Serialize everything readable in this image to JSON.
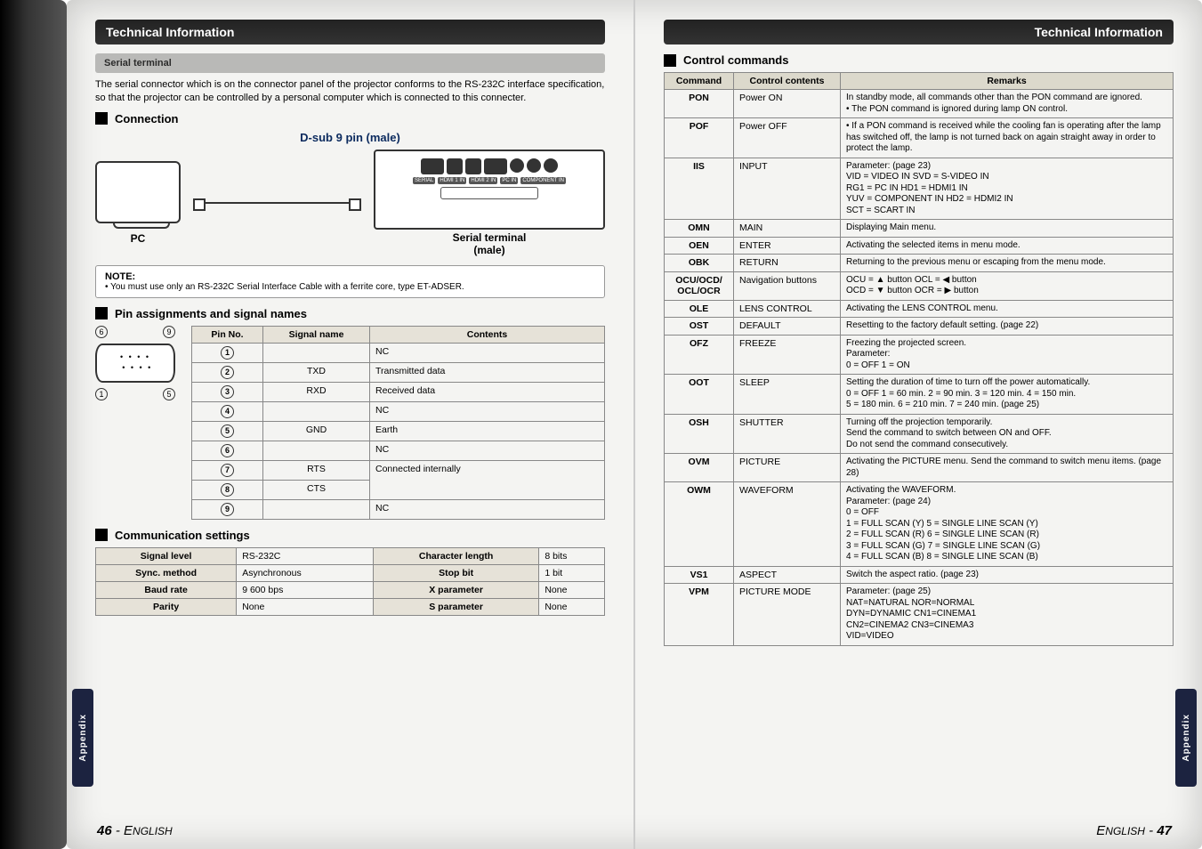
{
  "left": {
    "header": "Technical Information",
    "serial_hdr": "Serial terminal",
    "intro": "The serial connector which is on the connector panel of the projector conforms to the RS-232C interface specification, so that the projector can be controlled by a personal computer which is connected to this connecter.",
    "connection_title": "Connection",
    "dsub_label": "D-sub 9 pin (male)",
    "pc_label": "PC",
    "term_label1": "Serial terminal",
    "term_label2": "(male)",
    "note_title": "NOTE:",
    "note_body": "• You must use only an RS-232C Serial Interface Cable with a ferrite core, type ET-ADSER.",
    "pins_title": "Pin assignments and signal names",
    "pin_headers": [
      "Pin No.",
      "Signal name",
      "Contents"
    ],
    "pins": [
      {
        "n": "1",
        "sig": "",
        "cont": "NC"
      },
      {
        "n": "2",
        "sig": "TXD",
        "cont": "Transmitted data"
      },
      {
        "n": "3",
        "sig": "RXD",
        "cont": "Received data"
      },
      {
        "n": "4",
        "sig": "",
        "cont": "NC"
      },
      {
        "n": "5",
        "sig": "GND",
        "cont": "Earth"
      },
      {
        "n": "6",
        "sig": "",
        "cont": "NC"
      },
      {
        "n": "7",
        "sig": "RTS",
        "cont": "Connected internally"
      },
      {
        "n": "8",
        "sig": "CTS",
        "cont": ""
      },
      {
        "n": "9",
        "sig": "",
        "cont": "NC"
      }
    ],
    "dia_top": [
      "6",
      "9"
    ],
    "dia_bot": [
      "1",
      "5"
    ],
    "comm_title": "Communication settings",
    "comm": [
      {
        "k1": "Signal level",
        "v1": "RS-232C",
        "k2": "Character length",
        "v2": "8 bits"
      },
      {
        "k1": "Sync. method",
        "v1": "Asynchronous",
        "k2": "Stop bit",
        "v2": "1 bit"
      },
      {
        "k1": "Baud rate",
        "v1": "9 600 bps",
        "k2": "X parameter",
        "v2": "None"
      },
      {
        "k1": "Parity",
        "v1": "None",
        "k2": "S parameter",
        "v2": "None"
      }
    ],
    "appendix": "Appendix",
    "footer": "46 - ENGLISH"
  },
  "right": {
    "header": "Technical Information",
    "cc_title": "Control commands",
    "cmd_headers": [
      "Command",
      "Control contents",
      "Remarks"
    ],
    "cmds": [
      {
        "c": "PON",
        "n": "Power ON",
        "r": "In standby mode, all commands other than the PON command are ignored.\n• The PON command is ignored during lamp ON control."
      },
      {
        "c": "POF",
        "n": "Power OFF",
        "r": "• If a PON command is received while the cooling fan is operating after the lamp has switched off, the lamp is not turned back on again straight away in order to protect the lamp."
      },
      {
        "c": "IIS",
        "n": "INPUT",
        "r": "Parameter: (page 23)\nVID = VIDEO IN          SVD = S-VIDEO IN\nRG1 = PC IN             HD1 = HDMI1 IN\nYUV = COMPONENT IN      HD2 = HDMI2 IN\n                        SCT = SCART IN"
      },
      {
        "c": "OMN",
        "n": "MAIN",
        "r": "Displaying Main menu."
      },
      {
        "c": "OEN",
        "n": "ENTER",
        "r": "Activating the selected items in menu mode."
      },
      {
        "c": "OBK",
        "n": "RETURN",
        "r": "Returning to the previous menu or escaping from the menu mode."
      },
      {
        "c": "OCU/OCD/ OCL/OCR",
        "n": "Navigation buttons",
        "r": "OCU = ▲ button        OCL = ◀ button\nOCD = ▼ button        OCR = ▶ button"
      },
      {
        "c": "OLE",
        "n": "LENS CONTROL",
        "r": "Activating the LENS CONTROL menu."
      },
      {
        "c": "OST",
        "n": "DEFAULT",
        "r": "Resetting to the factory default setting. (page 22)"
      },
      {
        "c": "OFZ",
        "n": "FREEZE",
        "r": "Freezing the projected screen.\nParameter:\n0 = OFF                 1 = ON"
      },
      {
        "c": "OOT",
        "n": "SLEEP",
        "r": "Setting the duration of time to turn off the power automatically.\n0 = OFF   1 = 60 min.   2 = 90 min.   3 = 120 min.   4 = 150 min.\n5 = 180 min.   6 = 210 min.   7 = 240 min.   (page 25)"
      },
      {
        "c": "OSH",
        "n": "SHUTTER",
        "r": "Turning off the projection temporarily.\nSend the command to switch between ON and OFF.\nDo not send the command consecutively."
      },
      {
        "c": "OVM",
        "n": "PICTURE",
        "r": "Activating the PICTURE menu. Send the command to switch menu items. (page 28)"
      },
      {
        "c": "OWM",
        "n": "WAVEFORM",
        "r": "Activating the WAVEFORM.\nParameter:              (page 24)\n0 = OFF\n1 = FULL SCAN (Y)       5 = SINGLE LINE SCAN (Y)\n2 = FULL SCAN (R)       6 = SINGLE LINE SCAN (R)\n3 = FULL SCAN (G)       7 = SINGLE LINE SCAN (G)\n4 = FULL SCAN (B)       8 = SINGLE LINE SCAN (B)"
      },
      {
        "c": "VS1",
        "n": "ASPECT",
        "r": "Switch the aspect ratio. (page 23)"
      },
      {
        "c": "VPM",
        "n": "PICTURE MODE",
        "r": "Parameter: (page 25)\nNAT=NATURAL            NOR=NORMAL\nDYN=DYNAMIC            CN1=CINEMA1\nCN2=CINEMA2            CN3=CINEMA3\nVID=VIDEO"
      }
    ],
    "appendix": "Appendix",
    "footer": "ENGLISH - 47"
  }
}
